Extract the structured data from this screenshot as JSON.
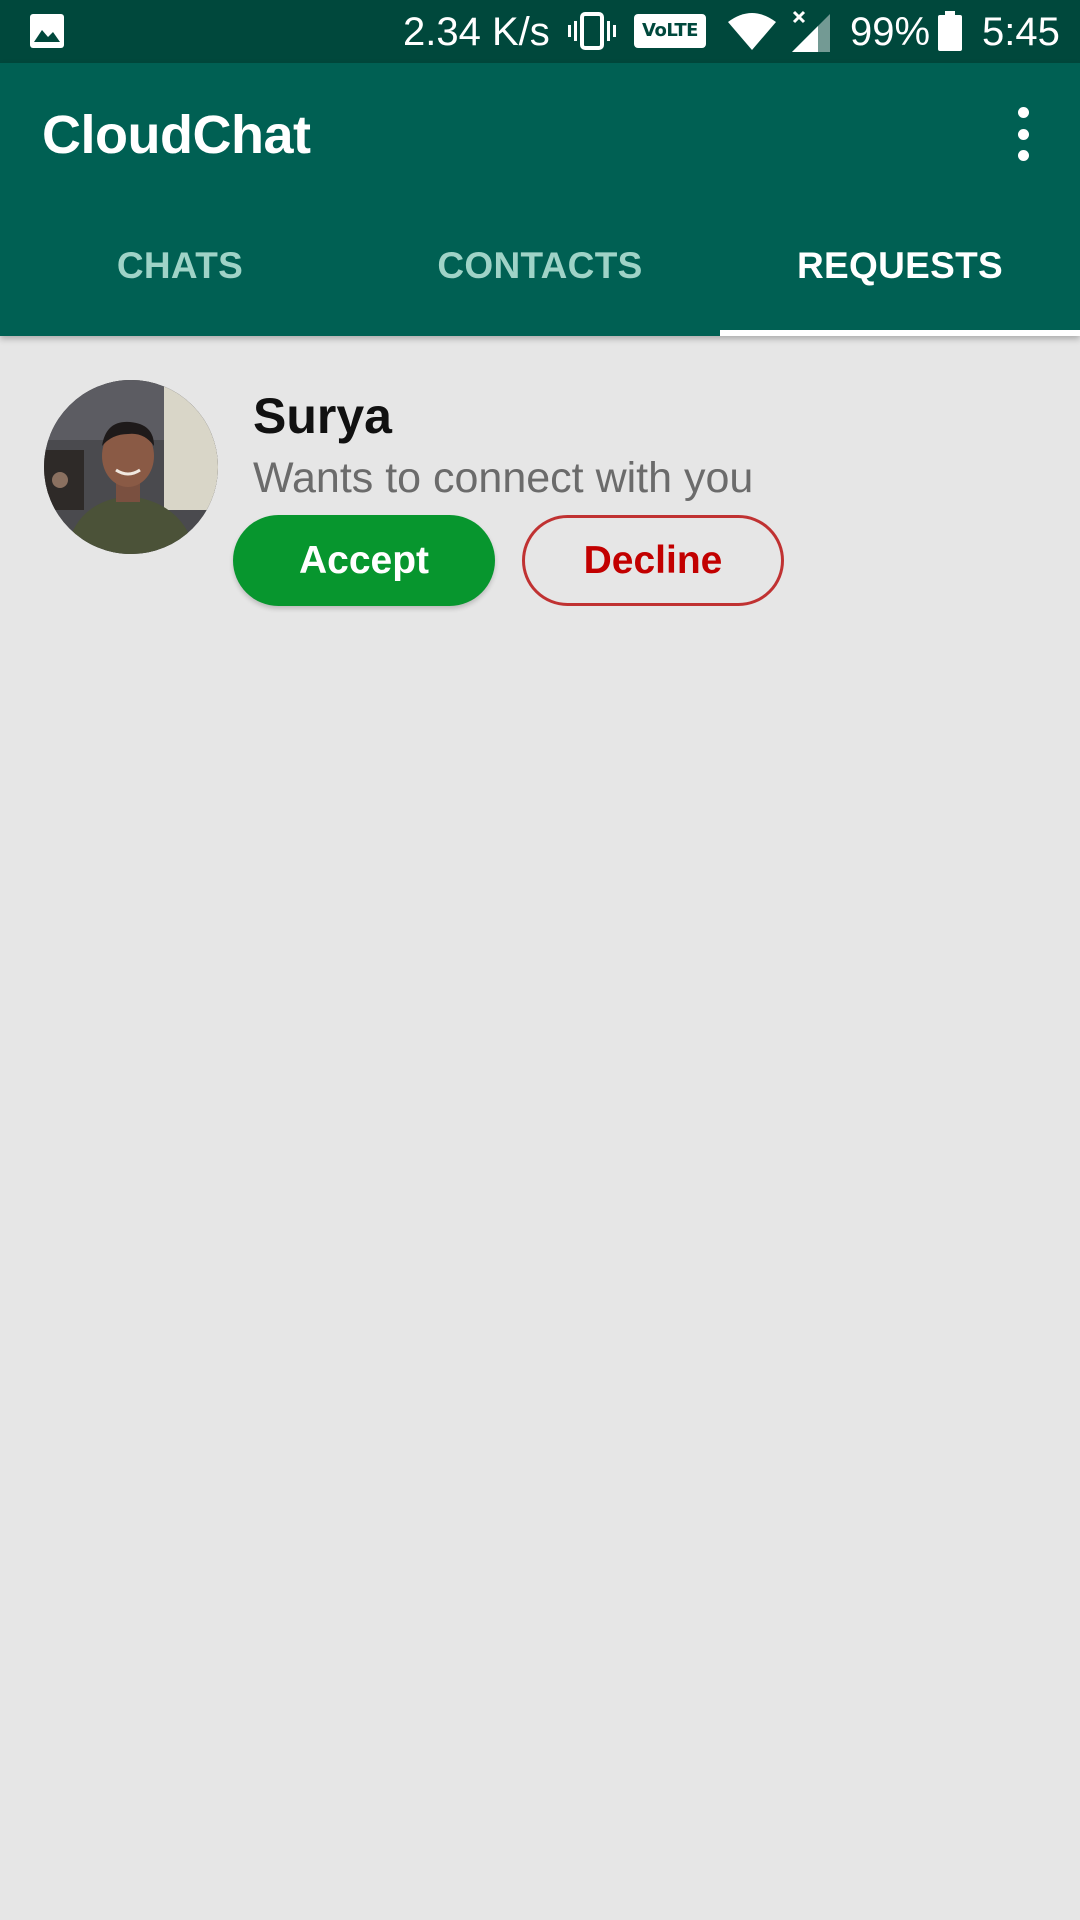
{
  "status_bar": {
    "network_speed": "2.34 K/s",
    "volte_label": "VoLTE",
    "battery_percent": "99%",
    "time": "5:45",
    "icons": [
      "gallery-icon",
      "vibrate-icon",
      "volte-icon",
      "wifi-icon",
      "signal-icon",
      "battery-icon"
    ]
  },
  "app_bar": {
    "title": "CloudChat",
    "menu_icon": "more-vertical-icon"
  },
  "tabs": [
    {
      "label": "CHATS",
      "active": false
    },
    {
      "label": "CONTACTS",
      "active": false
    },
    {
      "label": "REQUESTS",
      "active": true
    }
  ],
  "requests": [
    {
      "name": "Surya",
      "message": "Wants to connect with you",
      "accept_label": "Accept",
      "decline_label": "Decline"
    }
  ],
  "colors": {
    "status_bar": "#00483c",
    "app_bar": "#006053",
    "background": "#e6e6e6",
    "accept": "#07962e",
    "decline": "#c20000"
  }
}
